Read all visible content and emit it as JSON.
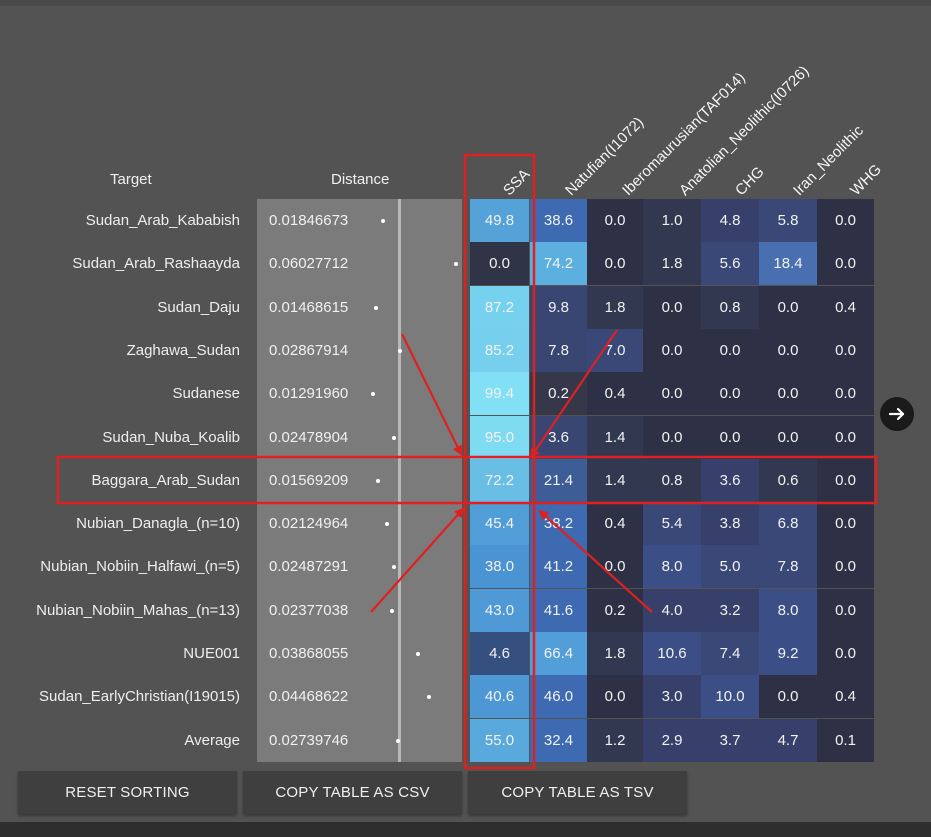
{
  "table": {
    "target_header": "Target",
    "distance_header": "Distance",
    "columns": [
      "SSA",
      "Natufian(I1072)",
      "Iberomaurusian(TAF014)",
      "Anatolian_Neolithic(I0726)",
      "CHG",
      "Iran_Neolithic",
      "WHG"
    ],
    "rows": [
      {
        "target": "Sudan_Arab_Kababish",
        "distance": "0.01846673",
        "values": [
          "49.8",
          "38.6",
          "0.0",
          "1.0",
          "4.8",
          "5.8",
          "0.0"
        ]
      },
      {
        "target": "Sudan_Arab_Rashaayda",
        "distance": "0.06027712",
        "values": [
          "0.0",
          "74.2",
          "0.0",
          "1.8",
          "5.6",
          "18.4",
          "0.0"
        ]
      },
      {
        "target": "Sudan_Daju",
        "distance": "0.01468615",
        "values": [
          "87.2",
          "9.8",
          "1.8",
          "0.0",
          "0.8",
          "0.0",
          "0.4"
        ]
      },
      {
        "target": "Zaghawa_Sudan",
        "distance": "0.02867914",
        "values": [
          "85.2",
          "7.8",
          "7.0",
          "0.0",
          "0.0",
          "0.0",
          "0.0"
        ]
      },
      {
        "target": "Sudanese",
        "distance": "0.01291960",
        "values": [
          "99.4",
          "0.2",
          "0.4",
          "0.0",
          "0.0",
          "0.0",
          "0.0"
        ]
      },
      {
        "target": "Sudan_Nuba_Koalib",
        "distance": "0.02478904",
        "values": [
          "95.0",
          "3.6",
          "1.4",
          "0.0",
          "0.0",
          "0.0",
          "0.0"
        ]
      },
      {
        "target": "Baggara_Arab_Sudan",
        "distance": "0.01569209",
        "values": [
          "72.2",
          "21.4",
          "1.4",
          "0.8",
          "3.6",
          "0.6",
          "0.0"
        ]
      },
      {
        "target": "Nubian_Danagla_(n=10)",
        "distance": "0.02124964",
        "values": [
          "45.4",
          "38.2",
          "0.4",
          "5.4",
          "3.8",
          "6.8",
          "0.0"
        ]
      },
      {
        "target": "Nubian_Nobiin_Halfawi_(n=5)",
        "distance": "0.02487291",
        "values": [
          "38.0",
          "41.2",
          "0.0",
          "8.0",
          "5.0",
          "7.8",
          "0.0"
        ]
      },
      {
        "target": "Nubian_Nobiin_Mahas_(n=13)",
        "distance": "0.02377038",
        "values": [
          "43.0",
          "41.6",
          "0.2",
          "4.0",
          "3.2",
          "8.0",
          "0.0"
        ]
      },
      {
        "target": "NUE001",
        "distance": "0.03868055",
        "values": [
          "4.6",
          "66.4",
          "1.8",
          "10.6",
          "7.4",
          "9.2",
          "0.0"
        ]
      },
      {
        "target": "Sudan_EarlyChristian(I19015)",
        "distance": "0.04468622",
        "values": [
          "40.6",
          "46.0",
          "0.0",
          "3.0",
          "10.0",
          "0.0",
          "0.4"
        ]
      },
      {
        "target": "Average",
        "distance": "0.02739746",
        "values": [
          "55.0",
          "32.4",
          "1.2",
          "2.9",
          "3.7",
          "4.7",
          "0.1"
        ]
      }
    ]
  },
  "buttons": {
    "reset": "RESET SORTING",
    "copy_csv": "COPY TABLE AS CSV",
    "copy_tsv": "COPY TABLE AS TSV"
  },
  "icons": {
    "next": "arrow-right-icon"
  },
  "colors": {
    "highlight": "#e02020",
    "background": "#535353"
  }
}
